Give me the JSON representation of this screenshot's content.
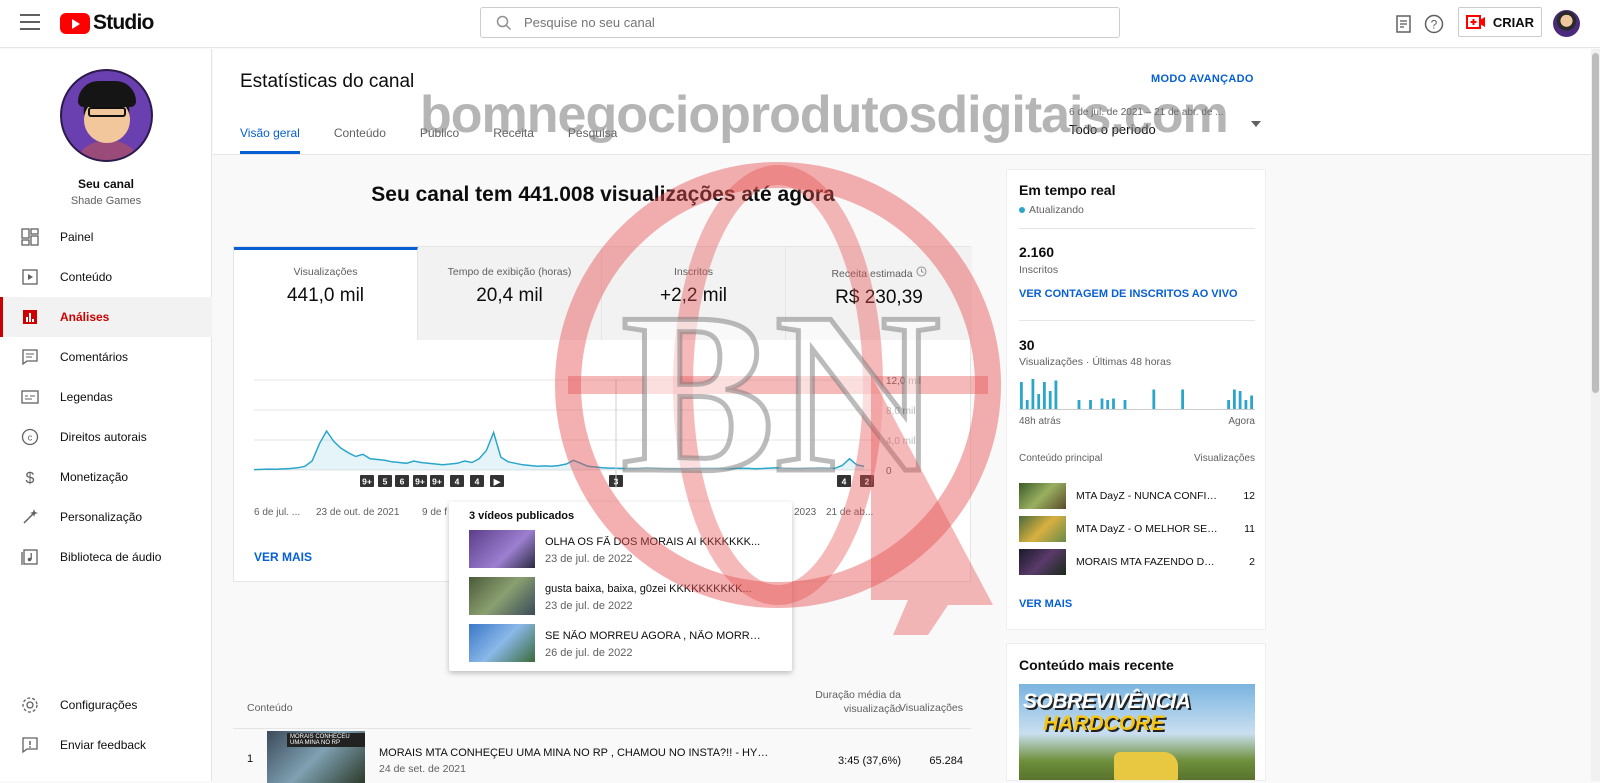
{
  "topbar": {
    "logo_text": "Studio",
    "search_placeholder": "Pesquise no seu canal",
    "create_label": "CRIAR"
  },
  "sidebar": {
    "channel_title": "Seu canal",
    "channel_name": "Shade Games",
    "items": [
      {
        "label": "Painel",
        "icon": "dashboard-icon"
      },
      {
        "label": "Conteúdo",
        "icon": "content-icon"
      },
      {
        "label": "Análises",
        "icon": "analytics-icon",
        "active": true
      },
      {
        "label": "Comentários",
        "icon": "comments-icon"
      },
      {
        "label": "Legendas",
        "icon": "subtitles-icon"
      },
      {
        "label": "Direitos autorais",
        "icon": "copyright-icon"
      },
      {
        "label": "Monetização",
        "icon": "dollar-icon"
      },
      {
        "label": "Personalização",
        "icon": "magic-wand-icon"
      },
      {
        "label": "Biblioteca de áudio",
        "icon": "audio-library-icon"
      }
    ],
    "bottom_items": [
      {
        "label": "Configurações",
        "icon": "gear-icon"
      },
      {
        "label": "Enviar feedback",
        "icon": "feedback-icon"
      }
    ]
  },
  "header": {
    "title": "Estatísticas do canal",
    "advanced_mode": "MODO AVANÇADO",
    "tabs": [
      "Visão geral",
      "Conteúdo",
      "Público",
      "Receita",
      "Pesquisa"
    ],
    "period_range": "6 de jul. de 2021 – 21 de abr. de ...",
    "period_name": "Todo o período"
  },
  "overview": {
    "heading": "Seu canal tem 441.008 visualizações até agora",
    "metrics": [
      {
        "label": "Visualizações",
        "value": "441,0 mil"
      },
      {
        "label": "Tempo de exibição (horas)",
        "value": "20,4 mil"
      },
      {
        "label": "Inscritos",
        "value": "+2,2 mil"
      },
      {
        "label": "Receita estimada",
        "value": "R$ 230,39"
      }
    ],
    "see_more": "VER MAIS"
  },
  "chart_data": {
    "type": "line",
    "x_tick_labels": [
      "6 de jul. ...",
      "23 de out. de 2021",
      "9 de f",
      "2023",
      "21 de ab..."
    ],
    "y_tick_labels": [
      "12,0 mil",
      "8,0 mil",
      "4,0 mil",
      "0"
    ],
    "ylim": [
      0,
      12000
    ],
    "series": [
      {
        "values": [
          60,
          80,
          120,
          100,
          150,
          200,
          300,
          500,
          1200,
          3500,
          5200,
          3800,
          2900,
          2300,
          1800,
          2100,
          1500,
          1400,
          1300,
          1100,
          1000,
          900,
          1200,
          1000,
          900,
          800,
          700,
          800,
          900,
          1200,
          1000,
          1500,
          2600,
          5000,
          1700,
          1100,
          900,
          700,
          600,
          500,
          550,
          500,
          600,
          800,
          1300,
          900,
          500,
          400,
          300,
          250,
          220,
          200,
          180,
          200,
          300,
          250,
          200,
          180,
          160,
          180,
          200,
          250,
          260,
          220,
          200,
          180,
          200,
          240,
          210,
          180,
          200,
          250,
          300,
          220,
          200,
          180,
          220,
          260,
          300,
          250,
          220,
          600,
          1500,
          700,
          500
        ]
      }
    ],
    "video_markers": [
      "9+",
      "5",
      "6",
      "9+",
      "9+",
      "4",
      "4",
      "▶",
      "3",
      "4",
      "2"
    ],
    "grid": true
  },
  "popup": {
    "title": "3 vídeos publicados",
    "items": [
      {
        "title": "OLHA OS FÃ DOS MORAIS AI KKKKKKK...",
        "date": "23 de jul. de 2022"
      },
      {
        "title": "gusta baixa, baixa, g0zei KKKKKKKKKK...",
        "date": "23 de jul. de 2022"
      },
      {
        "title": "SE NÃO MORREU AGORA , NÃO MORRE...",
        "date": "26 de jul. de 2022"
      }
    ]
  },
  "table": {
    "col_content": "Conteúdo",
    "col_duration": "Duração média da visualização",
    "col_views": "Visualizações",
    "rows": [
      {
        "index": "1",
        "title": "MORAIS MTA CONHEÇEU UMA MINA NO RP , CHAMOU NO INSTA?!! - HYPE ROL...",
        "date": "24 de set. de 2021",
        "duration": "3:45  (37,6%)",
        "views": "65.284",
        "thumb_caption": "MORAIS CONHECEU UMA MINA NO RP"
      }
    ]
  },
  "realtime": {
    "title": "Em tempo real",
    "updating": "Atualizando",
    "subscribers": "2.160",
    "subscribers_label": "Inscritos",
    "live_link": "VER CONTAGEM DE INSCRITOS AO VIVO",
    "views": "30",
    "views_label": "Visualizações · Últimas 48 horas",
    "spark": [
      0.9,
      0.3,
      1.0,
      0.5,
      0.9,
      0.6,
      0.95,
      0,
      0,
      0,
      0.3,
      0,
      0.3,
      0,
      0.35,
      0.3,
      0.35,
      0,
      0.3,
      0,
      0,
      0,
      0,
      0.65,
      0,
      0,
      0,
      0,
      0.65,
      0,
      0,
      0,
      0,
      0,
      0,
      0,
      0.3,
      0.65,
      0.6,
      0.3,
      0.45
    ],
    "axis_left": "48h atrás",
    "axis_right": "Agora",
    "col_content": "Conteúdo principal",
    "col_views": "Visualizações",
    "items": [
      {
        "title": "MTA DayZ - NUNCA CONFIE ...",
        "views": "12"
      },
      {
        "title": "MTA DayZ - O MELHOR SER...",
        "views": "11"
      },
      {
        "title": "MORAIS MTA FAZENDO DAR...",
        "views": "2"
      }
    ],
    "see_more": "VER MAIS"
  },
  "recent": {
    "title": "Conteúdo mais recente",
    "thumb_line1": "SOBREVIVÊNCIA",
    "thumb_line2": "HARDCORE"
  },
  "watermark": {
    "text": "bomnegocioprodutosdigitais.com",
    "logo_letters": "BN"
  },
  "colors": {
    "accent": "#065fd4",
    "brand_red": "#ff0000",
    "chart_line": "#2ba6cb"
  }
}
